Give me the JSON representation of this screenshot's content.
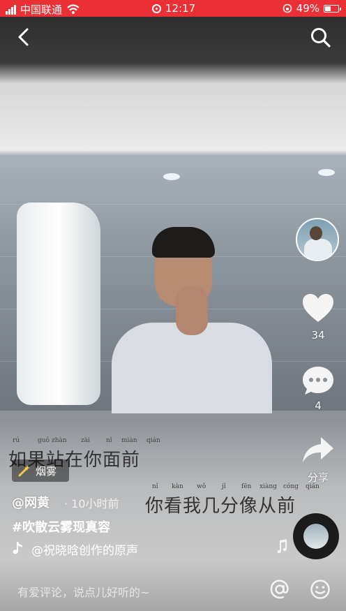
{
  "status_bar": {
    "carrier": "中国联通",
    "time": "12:17",
    "battery_percent": "49%",
    "battery_level": 0.49,
    "background": "#ea2f35"
  },
  "nav": {
    "back_icon": "chevron-left-icon",
    "search_icon": "search-icon"
  },
  "lyrics": [
    {
      "pinyin": [
        "rú",
        "guǒ",
        "zhàn",
        "zài",
        "nǐ",
        "miàn",
        "qián"
      ],
      "text": "如果站在你面前"
    },
    {
      "pinyin": [
        "nǐ",
        "kàn",
        "wǒ",
        "jǐ",
        "fēn",
        "xiàng",
        "cóng",
        "qián"
      ],
      "text": "你看我几分像从前"
    }
  ],
  "side_actions": {
    "like_count": "34",
    "comment_count": "4",
    "share_label": "分享"
  },
  "effect_tag": {
    "label": "烟雾",
    "icon": "magic-wand-icon"
  },
  "post": {
    "author": "@网黄",
    "time": "· 10小时前",
    "hashtag": "#吹散云雾现真容",
    "music": "@祝晓晗创作的原声"
  },
  "comment_bar": {
    "placeholder": "有爱评论，说点儿好听的~",
    "at_icon": "at-icon",
    "emoji_icon": "smiley-icon"
  }
}
